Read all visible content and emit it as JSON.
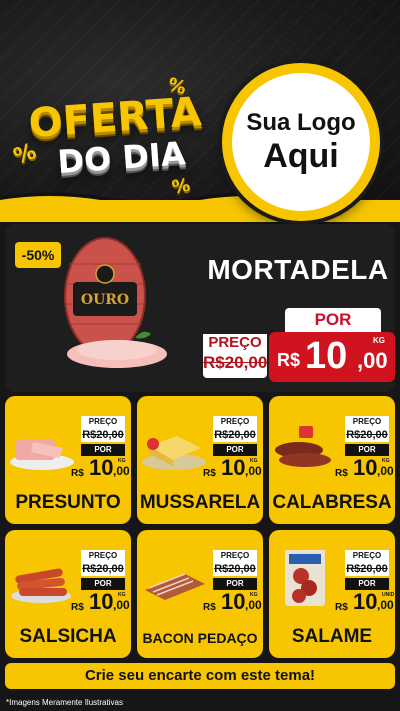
{
  "header": {
    "title_line1": "OFERTA",
    "title_line2": "DO DIA",
    "percent_symbol": "%",
    "logo_line1": "Sua Logo",
    "logo_line2": "Aqui"
  },
  "hero": {
    "discount": "-50%",
    "product_name": "MORTADELA",
    "brand_label": "OURO",
    "preco_label": "PREÇO",
    "old_price": "R$20,00",
    "por_label": "POR",
    "price_currency": "R$",
    "price_integer": "10",
    "price_cents": ",00",
    "price_unit": "KG"
  },
  "products": [
    {
      "name": "PRESUNTO",
      "preco_label": "PREÇO",
      "old_price": "R$20,00",
      "por_label": "POR",
      "currency": "R$",
      "price_integer": "10",
      "price_cents": ",00",
      "unit": "KG"
    },
    {
      "name": "MUSSARELA",
      "preco_label": "PREÇO",
      "old_price": "R$20,00",
      "por_label": "POR",
      "currency": "R$",
      "price_integer": "10",
      "price_cents": ",00",
      "unit": "KG"
    },
    {
      "name": "CALABRESA",
      "preco_label": "PREÇO",
      "old_price": "R$20,00",
      "por_label": "POR",
      "currency": "R$",
      "price_integer": "10",
      "price_cents": ",00",
      "unit": "KG"
    },
    {
      "name": "SALSICHA",
      "preco_label": "PREÇO",
      "old_price": "R$20,00",
      "por_label": "POR",
      "currency": "R$",
      "price_integer": "10",
      "price_cents": ",00",
      "unit": "KG"
    },
    {
      "name": "BACON PEDAÇO",
      "preco_label": "PREÇO",
      "old_price": "R$20,00",
      "por_label": "POR",
      "currency": "R$",
      "price_integer": "10",
      "price_cents": ",00",
      "unit": "KG"
    },
    {
      "name": "SALAME",
      "preco_label": "PREÇO",
      "old_price": "R$20,00",
      "por_label": "POR",
      "currency": "R$",
      "price_integer": "10",
      "price_cents": ",00",
      "unit": "UNID"
    }
  ],
  "cta": "Crie seu encarte com este tema!",
  "footnote": "*Imagens Meramente Ilustrativas",
  "colors": {
    "accent": "#f7c600",
    "price_red": "#d1121f",
    "background": "#161616"
  }
}
